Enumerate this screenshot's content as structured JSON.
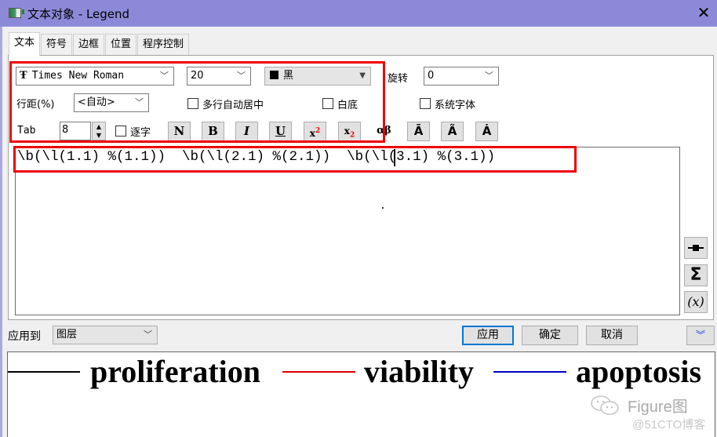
{
  "window": {
    "title": "文本对象 - Legend",
    "icon": "app-window-icon",
    "close_glyph": "✕"
  },
  "tabs": [
    {
      "label": "文本",
      "active": true
    },
    {
      "label": "符号",
      "active": false
    },
    {
      "label": "边框",
      "active": false
    },
    {
      "label": "位置",
      "active": false
    },
    {
      "label": "程序控制",
      "active": false
    }
  ],
  "text_tab": {
    "font": {
      "icon": "truetype-font-icon",
      "icon_glyph": "Ŧ",
      "value": "Times New Roman"
    },
    "size": {
      "value": "20"
    },
    "color": {
      "swatch": "#000000",
      "value": "黑"
    },
    "rotation": {
      "label": "旋转",
      "value": "0"
    },
    "line_spacing": {
      "label": "行距(%)",
      "value": "<自动>"
    },
    "multiline_center": {
      "label": "多行自动居中",
      "checked": false
    },
    "white_background": {
      "label": "白底",
      "checked": false
    },
    "system_font": {
      "label": "系统字体",
      "checked": false
    },
    "tab": {
      "label": "Tab",
      "value": "8"
    },
    "per_char": {
      "label": "逐字",
      "checked": false
    },
    "format_buttons": [
      {
        "name": "normal",
        "glyph": "N"
      },
      {
        "name": "bold",
        "glyph": "B"
      },
      {
        "name": "italic",
        "glyph": "I"
      },
      {
        "name": "underline",
        "glyph": "U"
      },
      {
        "name": "superscript",
        "glyph": "x",
        "sup": "2"
      },
      {
        "name": "subscript",
        "glyph": "x",
        "sub": "2"
      },
      {
        "name": "greek",
        "glyph": "αβ"
      },
      {
        "name": "bar-accent",
        "glyph": "Ā"
      },
      {
        "name": "tilde-accent",
        "glyph": "Ã"
      },
      {
        "name": "dot-accent",
        "glyph": "Ȧ"
      }
    ],
    "editor_text_parts": [
      "\\b(\\l(1.1) %(1.1))  \\b(\\l(2.1) %(2.1))  ",
      "\\b(\\l(3.1) %(3.1))"
    ],
    "side_buttons": [
      {
        "name": "symbol",
        "glyph": "-■-"
      },
      {
        "name": "sigma",
        "glyph": "Σ"
      },
      {
        "name": "variable",
        "glyph": "(x)"
      }
    ]
  },
  "apply_to": {
    "label": "应用到",
    "value": "图层"
  },
  "buttons": {
    "apply": "应用",
    "ok": "确定",
    "cancel": "取消",
    "expand_glyph": "︾"
  },
  "preview": {
    "entries": [
      {
        "label": "proliferation",
        "line_color": "#000000"
      },
      {
        "label": "viability",
        "line_color": "#e00000"
      },
      {
        "label": "apoptosis",
        "line_color": "#0000c0"
      }
    ]
  },
  "watermark": {
    "brand": "Figure图",
    "source": "@51CTO博客"
  },
  "highlight_color": "#ee0000"
}
